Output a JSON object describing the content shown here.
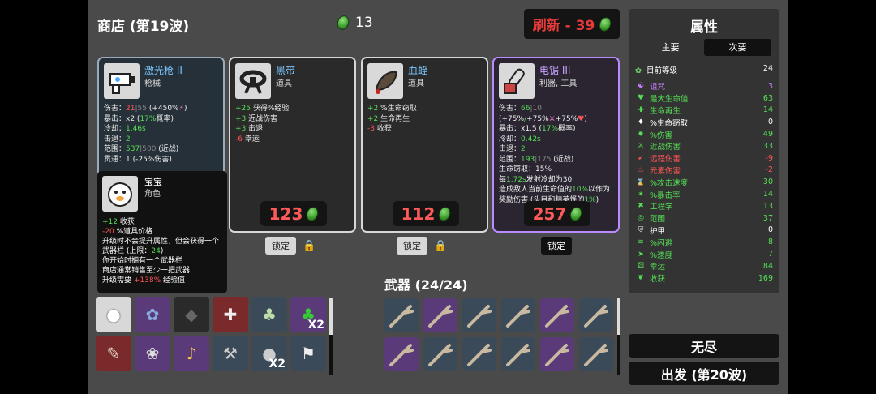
{
  "header": {
    "shop_title": "商店 (第19波)",
    "materials": "13",
    "reroll": "刷新 - 39"
  },
  "cards": [
    {
      "name": "激光枪 II",
      "type": "枪械",
      "price": "",
      "stats_html": "伤害：<span class='r'>21</span><span class='dim'>|55</span> (+450%<span style='color:#f7c'>⚡</span>)<br>暴击：x2 (<span class='g'>17%</span>概率)<br>冷却：<span class='g'>1.46s</span><br>击退：<span class='g'>2</span><br>范围：<span class='g'>537</span><span class='dim'>|500</span> (近战)<br>贯通：1 (-25%伤害)"
    },
    {
      "name": "黑带",
      "type": "道具",
      "price": "123",
      "stats_html": "<span class='g'>+25</span> 获得%经验<br><span class='g'>+3</span> 近战伤害<br><span class='g'>+3</span> 击退<br><span class='r'>-6</span> 幸运"
    },
    {
      "name": "血蛭",
      "type": "道具",
      "price": "112",
      "stats_html": "<span class='g'>+2</span> %生命窃取<br><span class='g'>+2</span> 生命再生<br><span class='r'>-3</span> 收获"
    },
    {
      "name": "电锯 III",
      "type": "利器, 工具",
      "price": "257",
      "stats_html": "伤害：<span class='g'>66</span><span class='dim'>|10</span> (+75%<span class='g'>/</span>+75%<span style='color:#f7c'>⚔</span>+75%<span class='r'>♥</span>)<br>暴击：x1.5 (<span class='g'>17%</span>概率)<br>冷却：<span class='g'>0.42s</span><br>击退：<span class='g'>2</span><br>范围：<span class='g'>193</span><span class='dim'>|175</span> (近战)<br>生命窃取：15%<br>每<span class='g'>1.72s</span>发射冷却为30<br>造成敌人当前生命值的<span class='g'>10%</span>以作为奖励伤害 (头目和精英怪的<span class='g'>1%</span>)"
    }
  ],
  "lock_label": "锁定",
  "character": {
    "name": "宝宝",
    "type": "角色",
    "text_html": "<span class='g'>+12</span> 收获<br><span class='r'>-20</span> %道具价格<br>升级时不会提升属性，但会获得一个武器栏 (上限：<span class='g'>24</span>)<br>你开始时拥有一个武器栏<br>商店通常销售至少一把武器<br>升级需要 <span class='r'>+138%</span> 经验值"
  },
  "item_counts": {
    "clover": "X2",
    "bomb": "X2"
  },
  "weapons_title": "武器 (24/24)",
  "attributes": {
    "title": "属性",
    "tab_main": "主要",
    "tab_secondary": "次要",
    "level_label": "目前等级",
    "level_value": "24",
    "rows": [
      {
        "label": "诅咒",
        "value": "3",
        "color": "#c77dff",
        "icon": "☯"
      },
      {
        "label": "最大生命值",
        "value": "63",
        "color": "#55e055",
        "icon": "♥"
      },
      {
        "label": "生命再生",
        "value": "14",
        "color": "#55e055",
        "icon": "✚"
      },
      {
        "label": "%生命窃取",
        "value": "0",
        "color": "#ffffff",
        "icon": "♦"
      },
      {
        "label": "%伤害",
        "value": "49",
        "color": "#55e055",
        "icon": "✸"
      },
      {
        "label": "近战伤害",
        "value": "33",
        "color": "#55e055",
        "icon": "⚔"
      },
      {
        "label": "远程伤害",
        "value": "-9",
        "color": "#ff5555",
        "icon": "➹"
      },
      {
        "label": "元素伤害",
        "value": "-2",
        "color": "#ff5555",
        "icon": "♨"
      },
      {
        "label": "%攻击速度",
        "value": "30",
        "color": "#55e055",
        "icon": "⌛"
      },
      {
        "label": "%暴击率",
        "value": "14",
        "color": "#55e055",
        "icon": "✶"
      },
      {
        "label": "工程学",
        "value": "13",
        "color": "#55e055",
        "icon": "✖"
      },
      {
        "label": "范围",
        "value": "37",
        "color": "#55e055",
        "icon": "◎"
      },
      {
        "label": "护甲",
        "value": "0",
        "color": "#ffffff",
        "icon": "⛨"
      },
      {
        "label": "%闪避",
        "value": "8",
        "color": "#55e055",
        "icon": "≋"
      },
      {
        "label": "%速度",
        "value": "7",
        "color": "#55e055",
        "icon": "➤"
      },
      {
        "label": "幸运",
        "value": "84",
        "color": "#55e055",
        "icon": "⚄"
      },
      {
        "label": "收获",
        "value": "169",
        "color": "#55e055",
        "icon": "❦"
      }
    ]
  },
  "endless": "无尽",
  "go": "出发 (第20波)"
}
